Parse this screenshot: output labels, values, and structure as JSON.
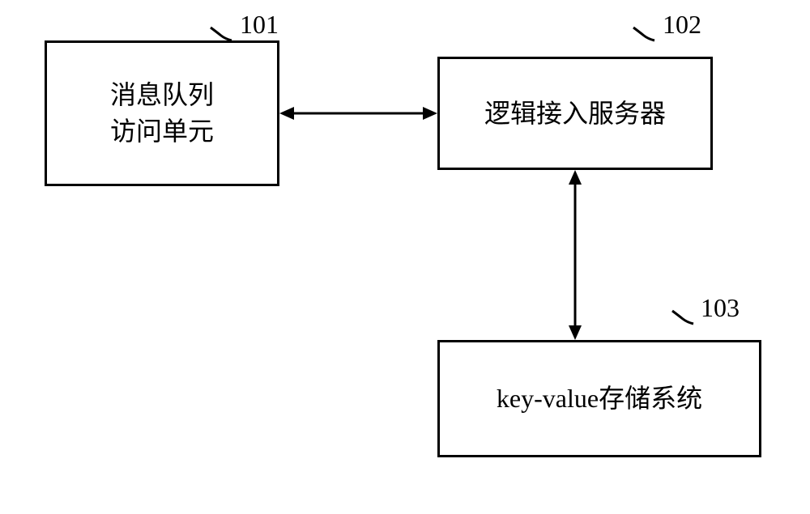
{
  "boxes": {
    "box101": {
      "number": "101",
      "label_line1": "消息队列",
      "label_line2": "访问单元"
    },
    "box102": {
      "number": "102",
      "label": "逻辑接入服务器"
    },
    "box103": {
      "number": "103",
      "label": "key-value存储系统"
    }
  }
}
